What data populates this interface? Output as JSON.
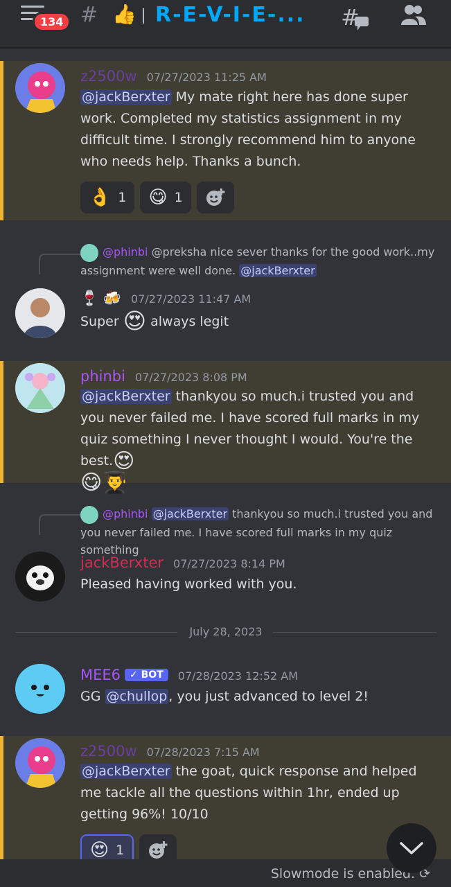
{
  "header": {
    "notification_count": "134",
    "emoji": "👍",
    "channel_name": "R-E-V-I-E-..."
  },
  "messages": [
    {
      "author": "z2500w",
      "author_color": "#6a3fa0",
      "time": "07/27/2023 11:25 AM",
      "mention": "@jackBerxter",
      "text": " My mate right here has done super work. Completed my statistics assignment in my difficult time. I strongly recommend him to anyone who needs help. Thanks a bunch.",
      "reactions": [
        {
          "emoji": "👌",
          "count": "1"
        },
        {
          "emoji": "😋",
          "count": "1"
        }
      ]
    },
    {
      "reply": {
        "author": "@phinbi",
        "text": " @preksha nice sever thanks for the good work..my assignment were well done. ",
        "mention": "@jackBerxter"
      },
      "author_emojis": "🍷 🍻",
      "time": "07/27/2023 11:47 AM",
      "text_a": "Super ",
      "emoji": "😍",
      "text_b": " always legit"
    },
    {
      "author": "phinbi",
      "author_color": "#a855f7",
      "time": "07/27/2023 8:08 PM",
      "mention": "@jackBerxter",
      "text": " thankyou so much.i trusted you and you never failed me. I have scored full marks in my quiz something I never thought I would. You're the best.",
      "emojis": "😍",
      "emojis_line2": "😋👨‍🎓"
    },
    {
      "reply": {
        "author": "@phinbi",
        "mention": "@jackBerxter",
        "text": " thankyou so much.i trusted you and you never failed me. I have scored full marks in my quiz something"
      },
      "author": "jackBerxter",
      "author_color": "#d12d55",
      "time": "07/27/2023 8:14 PM",
      "text": "Pleased having worked with you."
    },
    {
      "author": "MEE6",
      "author_color": "#a855f7",
      "bot_tag": "BOT",
      "time": "07/28/2023 12:52 AM",
      "text_a": "GG ",
      "mention": "@chullop",
      "text_b": ", you just advanced to level 2!"
    },
    {
      "author": "z2500w",
      "author_color": "#6a3fa0",
      "time": "07/28/2023 7:15 AM",
      "mention": "@jackBerxter",
      "text": "  the goat, quick response and helped me tackle all the questions within 1hr, ended up getting 96%! 10/10",
      "reactions": [
        {
          "emoji": "😍",
          "count": "1"
        }
      ]
    }
  ],
  "divider": {
    "label": "July 28, 2023"
  },
  "footer": {
    "slowmode": "Slowmode is enabled."
  }
}
